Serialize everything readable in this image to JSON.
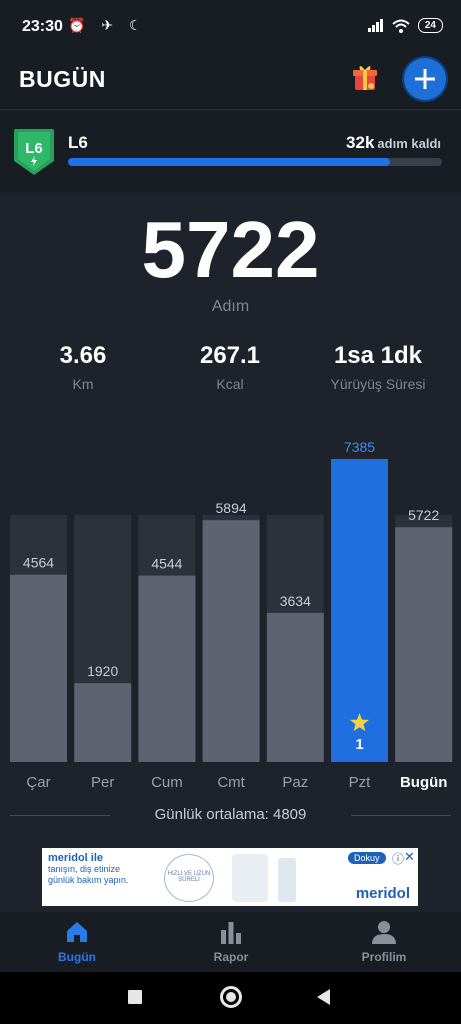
{
  "status_bar": {
    "time": "23:30",
    "battery": "24"
  },
  "header": {
    "title": "BUGÜN",
    "gift_icon": "gift-icon",
    "add_icon": "plus-icon"
  },
  "level": {
    "badge": "L6",
    "name": "L6",
    "remaining_value": "32k",
    "remaining_unit": "adım kaldı",
    "progress_fraction": 0.86
  },
  "summary": {
    "steps": "5722",
    "steps_label": "Adım",
    "stats": [
      {
        "value": "3.66",
        "label": "Km"
      },
      {
        "value": "267.1",
        "label": "Kcal"
      },
      {
        "value": "1sa 1dk",
        "label": "Yürüyüş Süresi"
      }
    ]
  },
  "chart_data": {
    "type": "bar",
    "categories": [
      "Çar",
      "Per",
      "Cum",
      "Cmt",
      "Paz",
      "Pzt",
      "Bugün"
    ],
    "values": [
      4564,
      1920,
      4544,
      5894,
      3634,
      7385,
      5722
    ],
    "highlight_index": 5,
    "today_index": 6,
    "goal_badge": "1",
    "colors": {
      "bar": "#5d6370",
      "track": "#2c313b",
      "highlight": "#1f6fe0",
      "highlight_label": "#3d8ef5",
      "star": "#f4d23c"
    }
  },
  "average": {
    "text": "Günlük ortalama: 4809"
  },
  "ad": {
    "brand": "meridol ile",
    "text": "tanışın, diş etinize günlük bakım yapın.",
    "circle_text": "HIZLI VE UZUN SÜRELİ",
    "cta": "Dokuy",
    "logo": "meridol"
  },
  "bottom_nav": [
    {
      "label": "Bugün",
      "icon": "home-icon",
      "active": true
    },
    {
      "label": "Rapor",
      "icon": "bar-chart-icon",
      "active": false
    },
    {
      "label": "Profilim",
      "icon": "profile-icon",
      "active": false
    }
  ]
}
